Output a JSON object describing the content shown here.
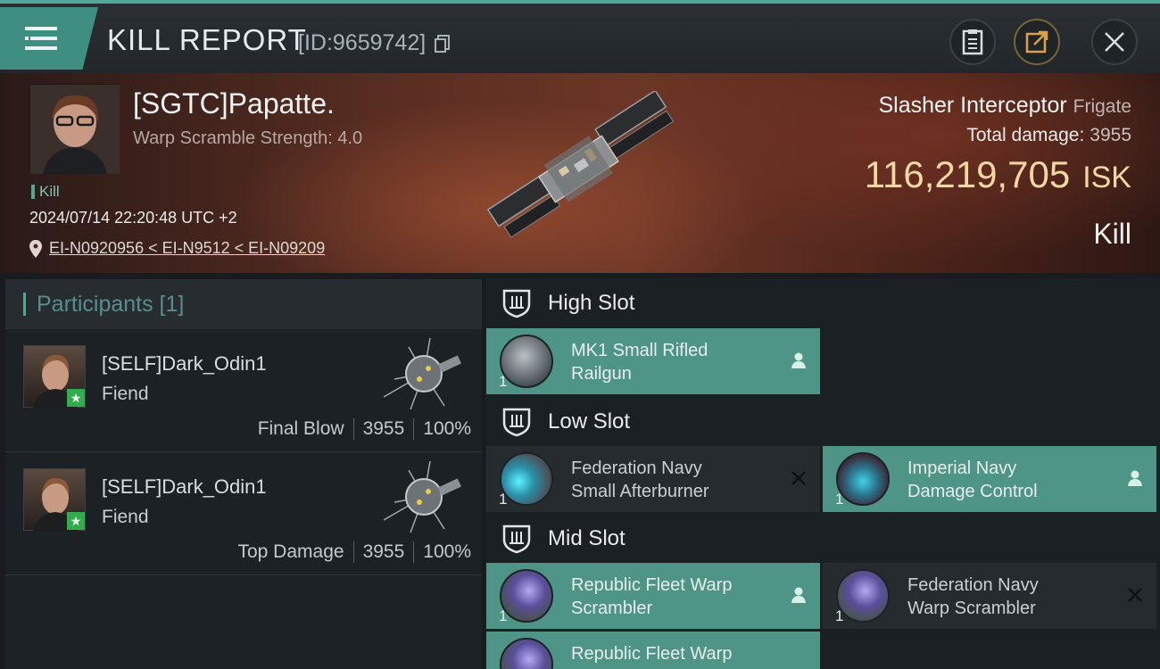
{
  "header": {
    "title": "KILL REPORT",
    "report_id": "[ID:9659742]"
  },
  "victim": {
    "name": "[SGTC]Papatte.",
    "stat": "Warp Scramble Strength: 4.0",
    "tag": "Kill",
    "datetime": "2024/07/14 22:20:48 UTC +2",
    "location": "EI-N0920956 < EI-N9512 < EI-N09209",
    "ship_name": "Slasher Interceptor",
    "ship_class": "Frigate",
    "damage_label": "Total damage:",
    "damage_value": "3955",
    "isk_value": "116,219,705",
    "isk_unit": "ISK",
    "result": "Kill"
  },
  "participants": {
    "title": "Participants [1]",
    "rows": [
      {
        "name": "[SELF]Dark_Odin1",
        "ship": "Fiend",
        "role": "Final Blow",
        "damage": "3955",
        "percent": "100%"
      },
      {
        "name": "[SELF]Dark_Odin1",
        "ship": "Fiend",
        "role": "Top Damage",
        "damage": "3955",
        "percent": "100%"
      }
    ]
  },
  "slots": {
    "high": {
      "label": "High Slot",
      "items": [
        {
          "name_line1": "MK1 Small Rifled",
          "name_line2": "Railgun",
          "qty": "1",
          "status": "person-icon"
        }
      ]
    },
    "low": {
      "label": "Low Slot",
      "items": [
        {
          "name_line1": "Federation Navy",
          "name_line2": "Small Afterburner",
          "qty": "1",
          "status": "destroyed-x-icon"
        },
        {
          "name_line1": "Imperial Navy",
          "name_line2": "Damage Control",
          "qty": "1",
          "status": "person-icon"
        }
      ]
    },
    "mid": {
      "label": "Mid Slot",
      "items": [
        {
          "name_line1": "Republic Fleet Warp",
          "name_line2": "Scrambler",
          "qty": "1",
          "status": "person-icon"
        },
        {
          "name_line1": "Federation Navy",
          "name_line2": "Warp Scrambler",
          "qty": "1",
          "status": "destroyed-x-icon"
        },
        {
          "name_line1": "Republic Fleet Warp",
          "name_line2": "",
          "qty": "",
          "status": ""
        }
      ]
    }
  },
  "colors": {
    "accent": "#4fa89a",
    "isk": "#f3d8a3",
    "dropped_item_bg": "#4e9587",
    "destroyed_item_bg": "#252b2f"
  }
}
